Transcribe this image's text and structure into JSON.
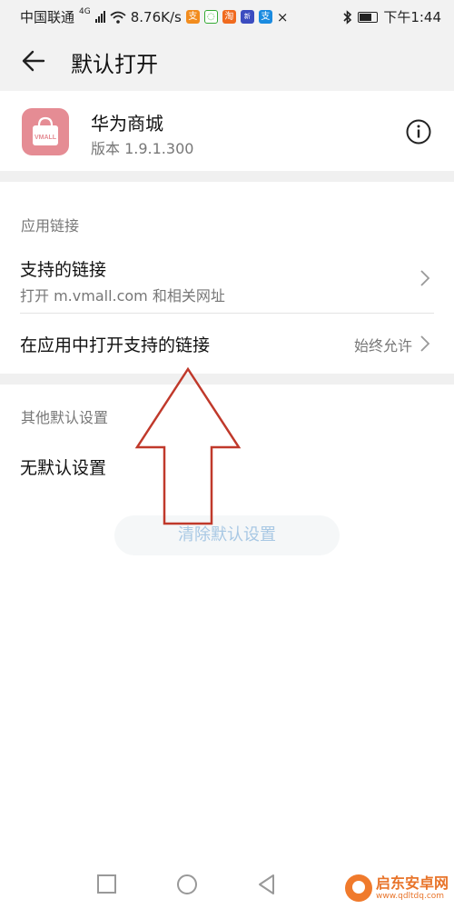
{
  "status_bar": {
    "carrier": "中国联通",
    "network": "4G",
    "speed": "8.76K/s",
    "time": "下午1:44",
    "icons": [
      "signal-icon",
      "wifi-icon",
      "app-notification-icon",
      "message-icon",
      "app-notification-icon",
      "app-notification-icon",
      "alipay-icon",
      "close-icon",
      "bluetooth-icon",
      "battery-icon"
    ]
  },
  "header": {
    "title": "默认打开",
    "back_icon": "arrow-left-icon"
  },
  "app": {
    "name": "华为商城",
    "version": "版本 1.9.1.300",
    "icon_text": "VMALL",
    "icon_color": "#e58c94"
  },
  "sections": {
    "app_links": {
      "label": "应用链接",
      "supported_links_title": "支持的链接",
      "supported_links_sub": "打开 m.vmall.com 和相关网址",
      "open_in_app_title": "在应用中打开支持的链接",
      "open_in_app_value": "始终允许"
    },
    "other_defaults": {
      "label": "其他默认设置",
      "no_default": "无默认设置",
      "clear_button": "清除默认设置"
    }
  },
  "watermark": {
    "name": "启东安卓网",
    "url": "www.qdltdq.com"
  },
  "colors": {
    "accent_disabled": "#a8c8e4",
    "annotation_arrow": "#c0392b"
  }
}
